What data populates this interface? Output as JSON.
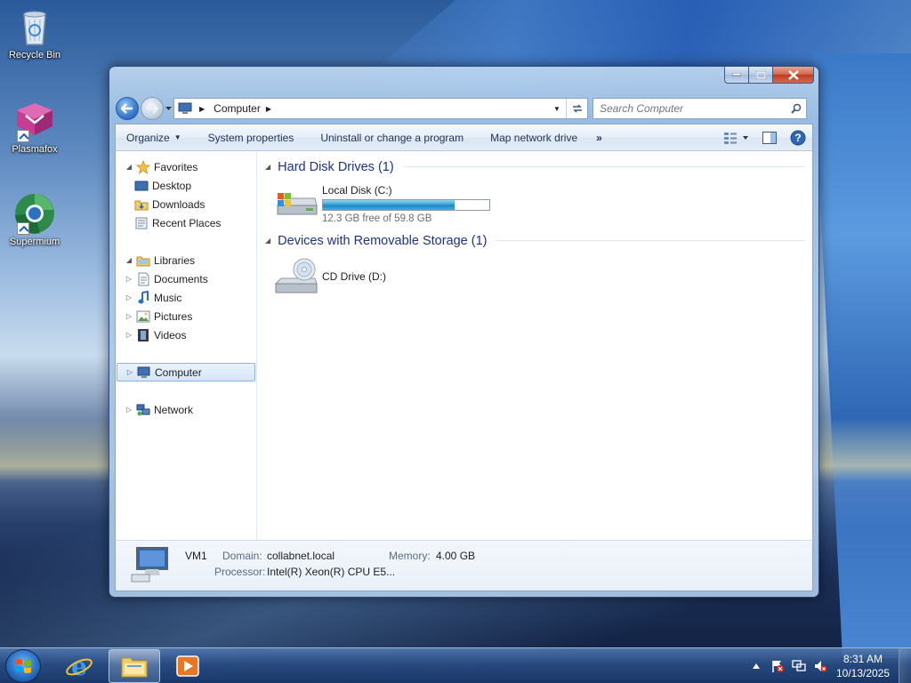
{
  "desktop": {
    "icons": [
      {
        "label": "Recycle Bin"
      },
      {
        "label": "Plasmafox"
      },
      {
        "label": "Supermium"
      }
    ]
  },
  "window": {
    "address": {
      "location": "Computer"
    },
    "search": {
      "placeholder": "Search Computer"
    },
    "toolbar": {
      "organize": "Organize",
      "system_properties": "System properties",
      "uninstall": "Uninstall or change a program",
      "map_drive": "Map network drive",
      "more": "»"
    },
    "nav": {
      "favorites": "Favorites",
      "desktop": "Desktop",
      "downloads": "Downloads",
      "recent": "Recent Places",
      "libraries": "Libraries",
      "documents": "Documents",
      "music": "Music",
      "pictures": "Pictures",
      "videos": "Videos",
      "computer": "Computer",
      "network": "Network"
    },
    "groups": {
      "hdd": "Hard Disk Drives (1)",
      "removable": "Devices with Removable Storage (1)"
    },
    "drives": {
      "c": {
        "label": "Local Disk (C:)",
        "free_text": "12.3 GB free of 59.8 GB",
        "used_fraction": 0.794
      },
      "d": {
        "label": "CD Drive (D:)"
      }
    },
    "details": {
      "name": "VM1",
      "domain_label": "Domain:",
      "domain_value": "collabnet.local",
      "memory_label": "Memory:",
      "memory_value": "4.00 GB",
      "processor_label": "Processor:",
      "processor_value": "Intel(R) Xeon(R) CPU E5..."
    }
  },
  "taskbar": {
    "time": "8:31 AM",
    "date": "10/13/2025"
  },
  "colors": {
    "group_heading": "#1e3287",
    "capacity_fill": "#2a96cc",
    "selection": "#d4e6fb"
  }
}
